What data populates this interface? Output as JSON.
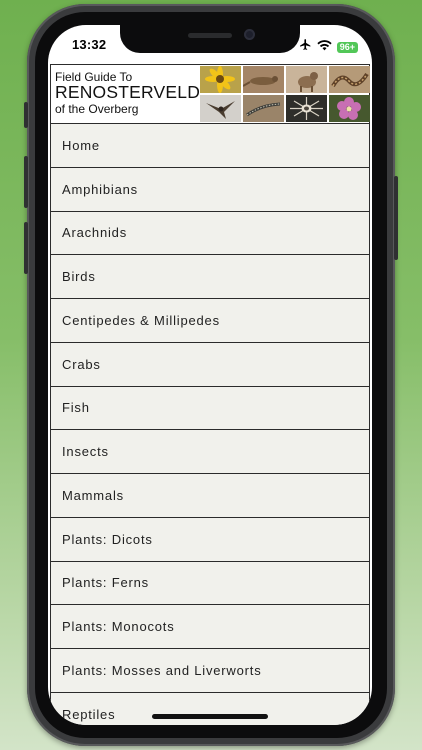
{
  "status_bar": {
    "time": "13:32",
    "battery": "96+",
    "icons": [
      "airplane-icon",
      "wifi-icon",
      "battery-icon"
    ]
  },
  "banner": {
    "line1": "Field Guide To",
    "line2": "RENOSTERVELD",
    "line3": "of the Overberg",
    "photos": [
      "yellow-flower-photo",
      "lizard-photo",
      "mammal-photo",
      "snake-photo",
      "bird-photo",
      "small-lizard-photo",
      "spider-photo",
      "pink-flower-photo"
    ]
  },
  "menu": {
    "items": [
      {
        "label": "Home"
      },
      {
        "label": "Amphibians"
      },
      {
        "label": "Arachnids"
      },
      {
        "label": "Birds"
      },
      {
        "label": "Centipedes & Millipedes"
      },
      {
        "label": "Crabs"
      },
      {
        "label": "Fish"
      },
      {
        "label": "Insects"
      },
      {
        "label": "Mammals"
      },
      {
        "label": "Plants: Dicots"
      },
      {
        "label": "Plants: Ferns"
      },
      {
        "label": "Plants: Monocots"
      },
      {
        "label": "Plants: Mosses and Liverworts"
      },
      {
        "label": "Reptiles"
      }
    ]
  },
  "colors": {
    "background": "#6fb04f",
    "list_background": "#f1f1ec",
    "divider": "#2b2b2b",
    "battery": "#52c758"
  }
}
